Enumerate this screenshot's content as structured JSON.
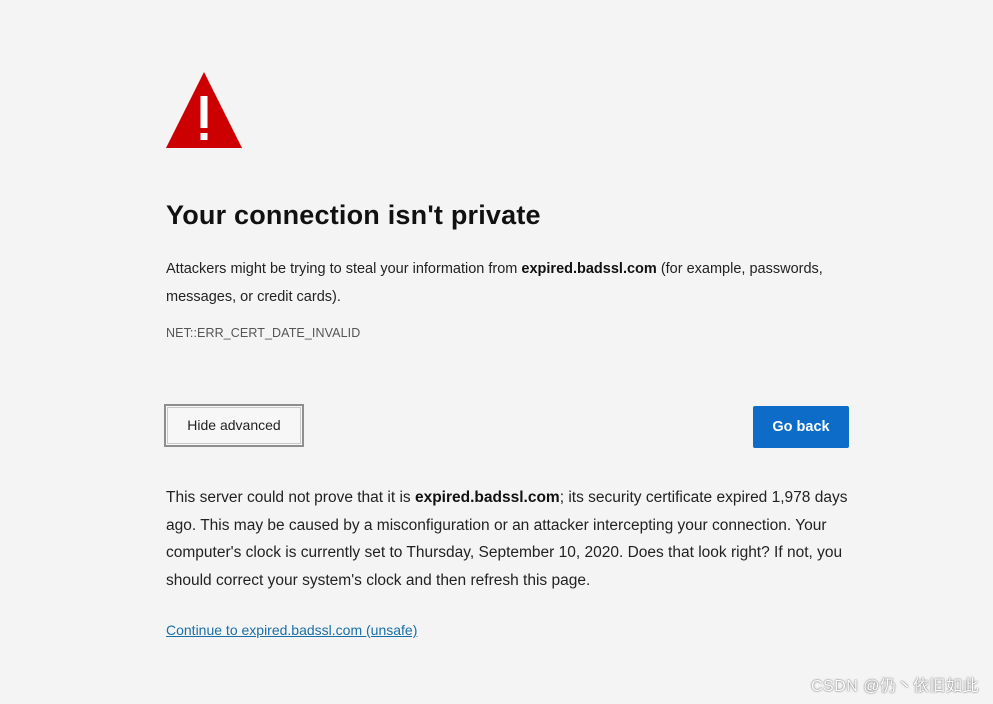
{
  "warning": {
    "icon": "warning-triangle-icon",
    "color": "#cc0000"
  },
  "title": "Your connection isn't private",
  "intro": {
    "before": "Attackers might be trying to steal your information from ",
    "host": "expired.badssl.com",
    "after": " (for example, passwords, messages, or credit cards)."
  },
  "error_code": "NET::ERR_CERT_DATE_INVALID",
  "buttons": {
    "hide_advanced": "Hide advanced",
    "go_back": "Go back",
    "go_back_color": "#0c6cc7"
  },
  "details": {
    "before": "This server could not prove that it is ",
    "host": "expired.badssl.com",
    "after": "; its security certificate expired 1,978 days ago. This may be caused by a misconfiguration or an attacker intercepting your connection. Your computer's clock is currently set to Thursday, September 10, 2020. Does that look right? If not, you should correct your system's clock and then refresh this page."
  },
  "continue_link": "Continue to expired.badssl.com (unsafe)",
  "watermark": "CSDN @仍丶依旧如此"
}
